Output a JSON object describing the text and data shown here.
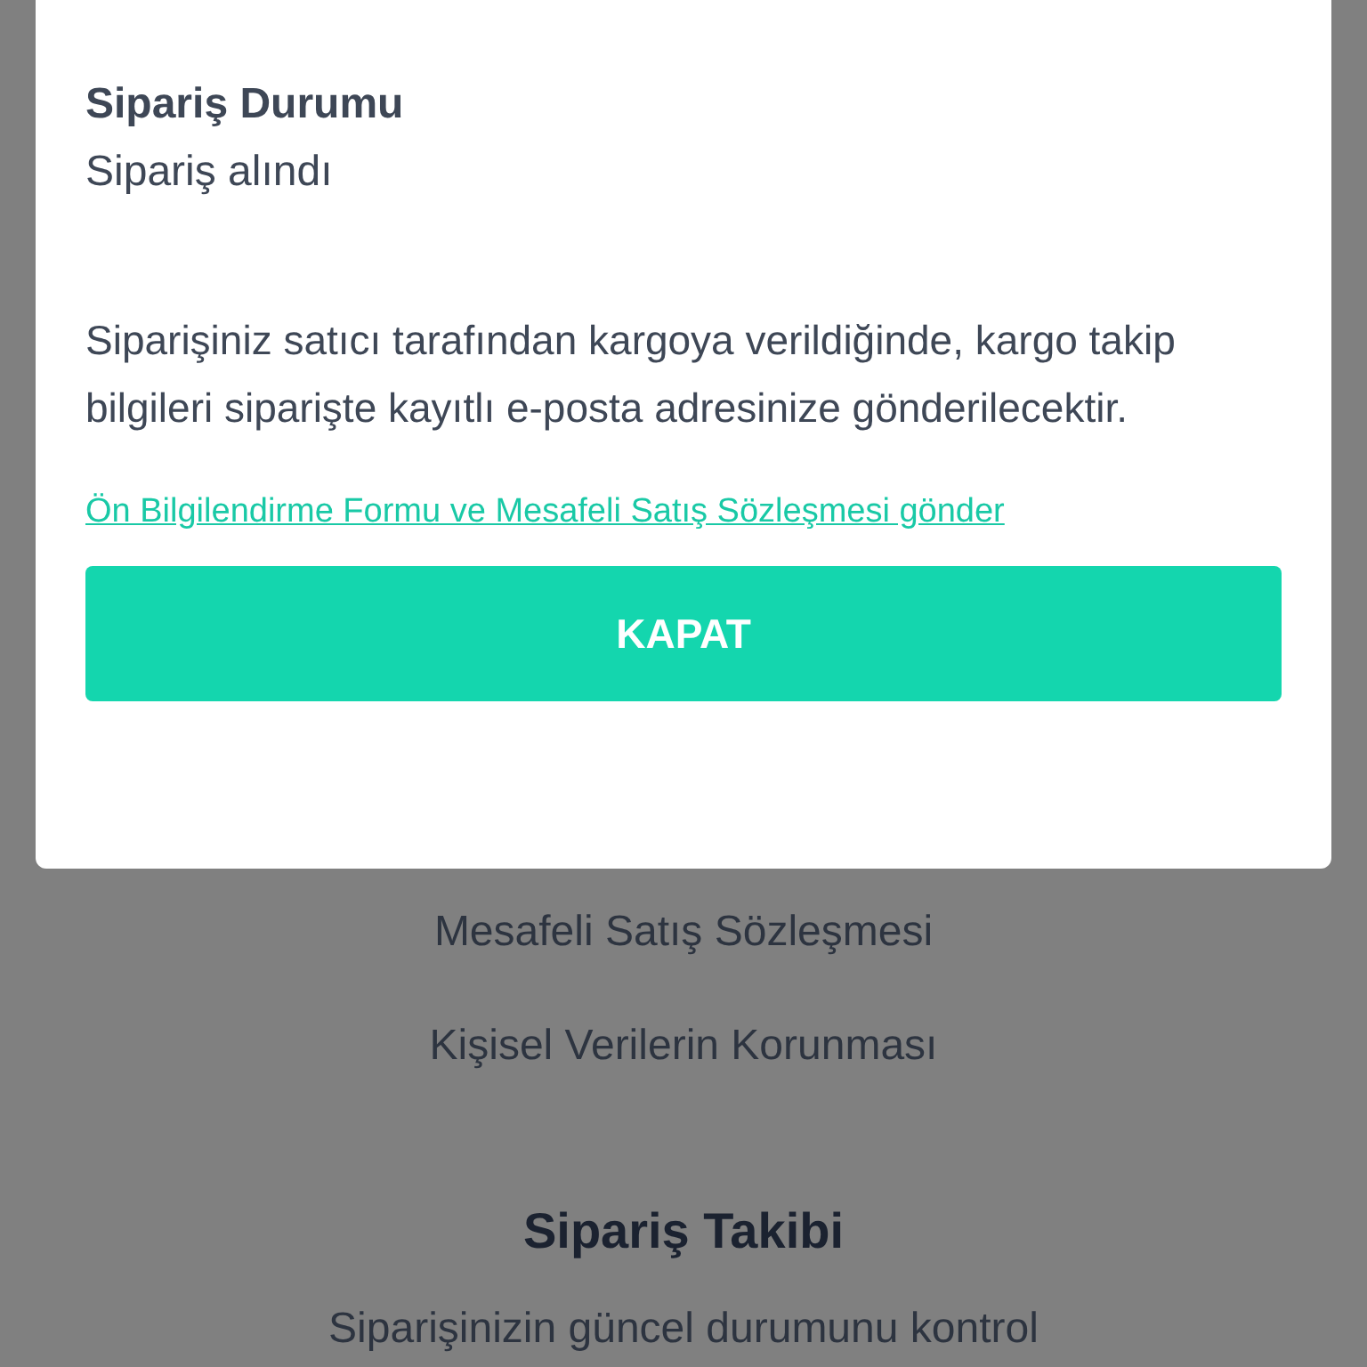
{
  "modal": {
    "status_label": "Sipariş Durumu",
    "status_value": "Sipariş alındı",
    "message": "Siparişiniz satıcı tarafından kargoya verildiğinde, kargo takip bilgileri siparişte kayıtlı e-posta adresinize gönderilecektir.",
    "link": "Ön Bilgilendirme Formu ve Mesafeli Satış Sözleşmesi gönder",
    "button": "KAPAT"
  },
  "background": {
    "links": [
      "Mesafeli Satış Sözleşmesi",
      "Kişisel Verilerin Korunması"
    ],
    "heading": "Sipariş Takibi",
    "text": "Siparişinizin güncel durumunu kontrol"
  }
}
